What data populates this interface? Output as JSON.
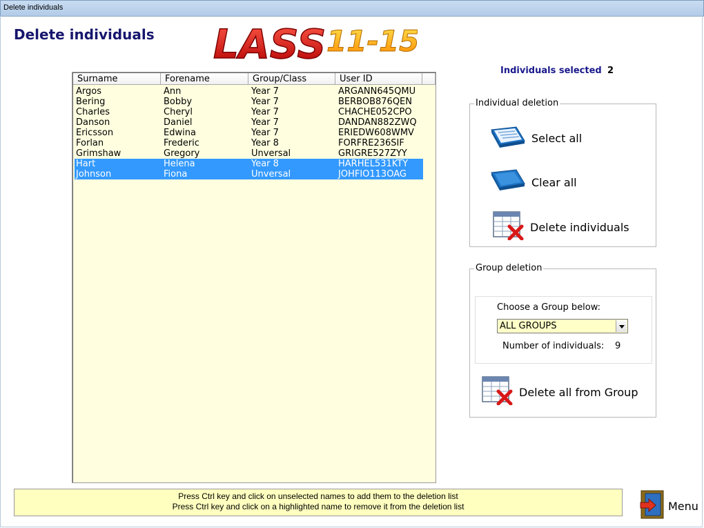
{
  "window": {
    "title": "Delete individuals"
  },
  "page": {
    "title": "Delete individuals"
  },
  "logo": {
    "text": "LASS 11-15",
    "main": "LASS",
    "range": "11-15"
  },
  "table": {
    "columns": [
      "Surname",
      "Forename",
      "Group/Class",
      "User ID"
    ],
    "rows": [
      {
        "surname": "Argos",
        "forename": "Ann",
        "group": "Year 7",
        "user_id": "ARGANN645QMU",
        "selected": false
      },
      {
        "surname": "Bering",
        "forename": "Bobby",
        "group": "Year 7",
        "user_id": "BERBOB876QEN",
        "selected": false
      },
      {
        "surname": "Charles",
        "forename": "Cheryl",
        "group": "Year 7",
        "user_id": "CHACHE052CPO",
        "selected": false
      },
      {
        "surname": "Danson",
        "forename": "Daniel",
        "group": "Year 7",
        "user_id": "DANDAN882ZWQ",
        "selected": false
      },
      {
        "surname": "Ericsson",
        "forename": "Edwina",
        "group": "Year 7",
        "user_id": "ERIEDW608WMV",
        "selected": false
      },
      {
        "surname": "Forlan",
        "forename": "Frederic",
        "group": "Year 8",
        "user_id": "FORFRE236SIF",
        "selected": false
      },
      {
        "surname": "Grimshaw",
        "forename": "Gregory",
        "group": "Unversal",
        "user_id": "GRIGRE527ZYY",
        "selected": false
      },
      {
        "surname": "Hart",
        "forename": "Helena",
        "group": "Year 8",
        "user_id": "HARHEL531KTY",
        "selected": true
      },
      {
        "surname": "Johnson",
        "forename": "Fiona",
        "group": "Unversal",
        "user_id": "JOHFIO113OAG",
        "selected": true
      }
    ]
  },
  "selection": {
    "label": "Individuals selected",
    "count": "2"
  },
  "individual_deletion": {
    "legend": "Individual deletion",
    "select_all": "Select all",
    "clear_all": "Clear all",
    "delete_individuals": "Delete individuals"
  },
  "group_deletion": {
    "legend": "Group deletion",
    "choose_label": "Choose a Group below:",
    "selected_group": "ALL GROUPS",
    "num_label": "Number of individuals:",
    "num_value": "9",
    "delete_all": "Delete all from Group"
  },
  "footer": {
    "line1": "Press Ctrl key and click on unselected names to add them to the deletion list",
    "line2": "Press Ctrl key and click on a highlighted name to remove it from the deletion list"
  },
  "menu": {
    "label": "Menu"
  },
  "colors": {
    "selection": "#3399ff",
    "list_bg": "#ffffe0",
    "title": "#16166e",
    "accent_label": "#1a1a8c",
    "footer_bg": "#ffffc0"
  }
}
